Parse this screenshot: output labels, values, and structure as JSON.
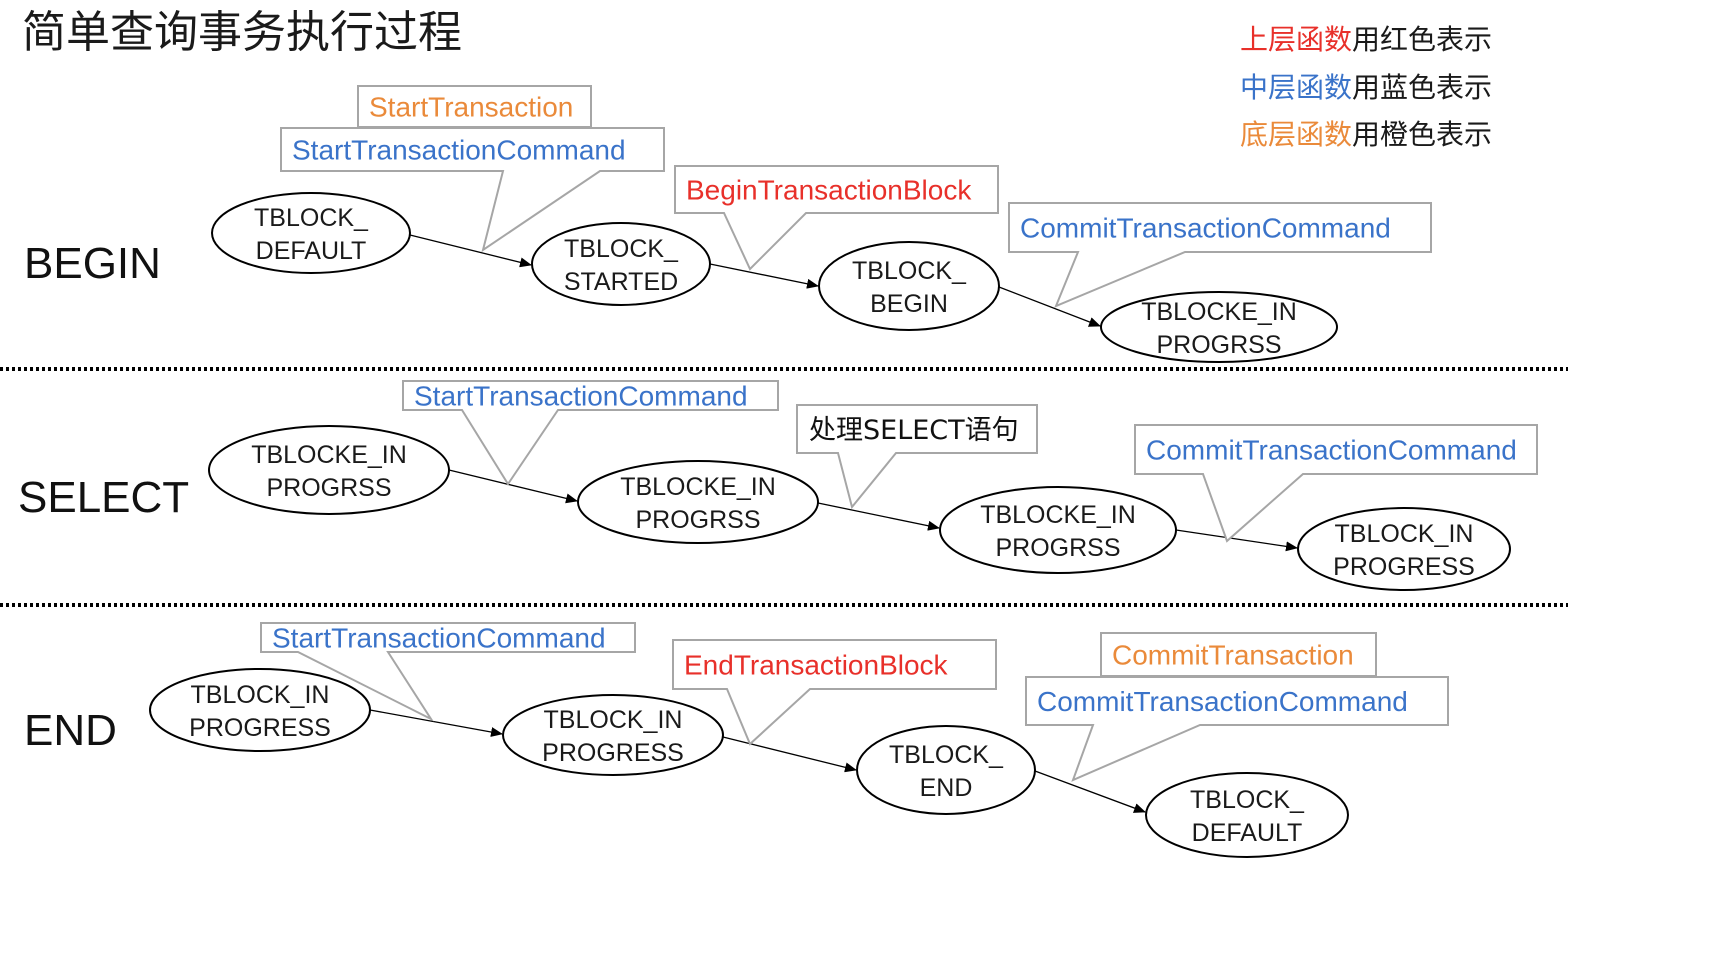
{
  "title": "简单查询事务执行过程",
  "colors": {
    "upper": "#e8302a",
    "middle": "#3a73c9",
    "lower": "#ea8a3a",
    "text": "#1a1a1a"
  },
  "legend": [
    {
      "colored": "上层函数",
      "plain": "用红色表示",
      "level": "upper"
    },
    {
      "colored": "中层函数",
      "plain": "用蓝色表示",
      "level": "middle"
    },
    {
      "colored": "底层函数",
      "plain": "用橙色表示",
      "level": "lower"
    }
  ],
  "rows": [
    {
      "label": "BEGIN",
      "states": [
        {
          "lines": [
            "TBLOCK_",
            "DEFAULT"
          ]
        },
        {
          "lines": [
            "TBLOCK_",
            "STARTED"
          ]
        },
        {
          "lines": [
            "TBLOCK_",
            "BEGIN"
          ]
        },
        {
          "lines": [
            "TBLOCKE_IN",
            "PROGRSS"
          ]
        }
      ],
      "calls": [
        {
          "text": "StartTransaction",
          "level": "lower"
        },
        {
          "text": "StartTransactionCommand",
          "level": "middle"
        },
        {
          "text": "BeginTransactionBlock",
          "level": "upper"
        },
        {
          "text": "CommitTransactionCommand",
          "level": "middle"
        }
      ]
    },
    {
      "label": "SELECT",
      "states": [
        {
          "lines": [
            "TBLOCKE_IN",
            "PROGRSS"
          ]
        },
        {
          "lines": [
            "TBLOCKE_IN",
            "PROGRSS"
          ]
        },
        {
          "lines": [
            "TBLOCKE_IN",
            "PROGRSS"
          ]
        },
        {
          "lines": [
            "TBLOCK_IN",
            "PROGRESS"
          ]
        }
      ],
      "calls": [
        {
          "text": "StartTransactionCommand",
          "level": "middle"
        },
        {
          "text": "处理SELECT语句",
          "level": "note"
        },
        {
          "text": "CommitTransactionCommand",
          "level": "middle"
        }
      ]
    },
    {
      "label": "END",
      "states": [
        {
          "lines": [
            "TBLOCK_IN",
            "PROGRESS"
          ]
        },
        {
          "lines": [
            "TBLOCK_IN",
            "PROGRESS"
          ]
        },
        {
          "lines": [
            "TBLOCK_",
            "END"
          ]
        },
        {
          "lines": [
            "TBLOCK_",
            "DEFAULT"
          ]
        }
      ],
      "calls": [
        {
          "text": "StartTransactionCommand",
          "level": "middle"
        },
        {
          "text": "EndTransactionBlock",
          "level": "upper"
        },
        {
          "text": "CommitTransaction",
          "level": "lower"
        },
        {
          "text": "CommitTransactionCommand",
          "level": "middle"
        }
      ]
    }
  ]
}
